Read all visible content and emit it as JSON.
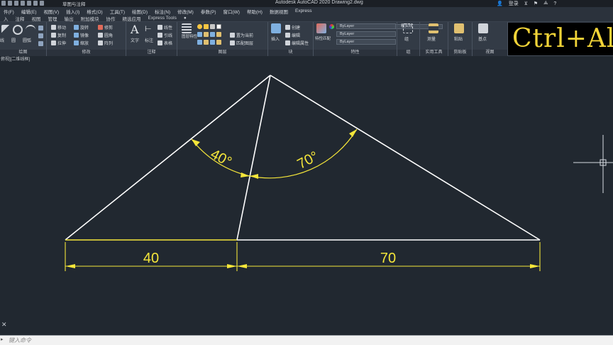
{
  "titlebar": {
    "workspace": "草图与注释",
    "app_title": "Autodesk AutoCAD 2020    Drawing2.dwg",
    "login": "登录"
  },
  "menubar": [
    "件(F)",
    "编辑(E)",
    "视图(V)",
    "插入(I)",
    "格式(O)",
    "工具(T)",
    "绘图(D)",
    "标注(N)",
    "修改(M)",
    "参数(P)",
    "窗口(W)",
    "帮助(H)",
    "数据视图",
    "Express"
  ],
  "ribbon_tabs": [
    "入",
    "注释",
    "视图",
    "管理",
    "输出",
    "附加模块",
    "协作",
    "精选应用",
    "Express Tools",
    "●"
  ],
  "ribbon": {
    "draw": {
      "title": "绘图",
      "tools": [
        "线",
        "圆",
        "圆弧"
      ]
    },
    "modify": {
      "title": "修改",
      "tools": [
        "移动",
        "旋转",
        "修剪",
        "复制",
        "镜像",
        "圆角",
        "拉伸",
        "缩放",
        "阵列"
      ]
    },
    "annotation": {
      "title": "注释",
      "tools": [
        "文字",
        "标注",
        "线性",
        "引线",
        "表格"
      ]
    },
    "layers": {
      "title": "图层",
      "tools": [
        "图层特性",
        "置为当前",
        "匹配图层"
      ],
      "current_layer": "粗实线"
    },
    "block": {
      "title": "块",
      "tools": [
        "插入",
        "创建",
        "编辑",
        "编辑属性"
      ]
    },
    "properties": {
      "title": "特性",
      "tools": [
        "特性匹配"
      ],
      "color": "ByLayer",
      "linetype": "ByLayer",
      "lineweight": "ByLayer"
    },
    "groups": {
      "title": "组",
      "tools": [
        "组"
      ]
    },
    "utilities": {
      "title": "实用工具",
      "tools": [
        "测量"
      ]
    },
    "clipboard": {
      "title": "剪贴板",
      "tools": [
        "粘贴"
      ]
    },
    "view": {
      "title": "视图",
      "tools": [
        "基点"
      ]
    }
  },
  "overlay_badge": "Ctrl+Al",
  "viewport_label": "俯视][二维线框]",
  "command_placeholder": "键入命令",
  "drawing": {
    "angle_left": "40°",
    "angle_right": "70°",
    "dim_left": "40",
    "dim_right": "70",
    "colors": {
      "geometry": "#ffffff",
      "dimension": "#f5e63a",
      "background": "#212830"
    }
  }
}
